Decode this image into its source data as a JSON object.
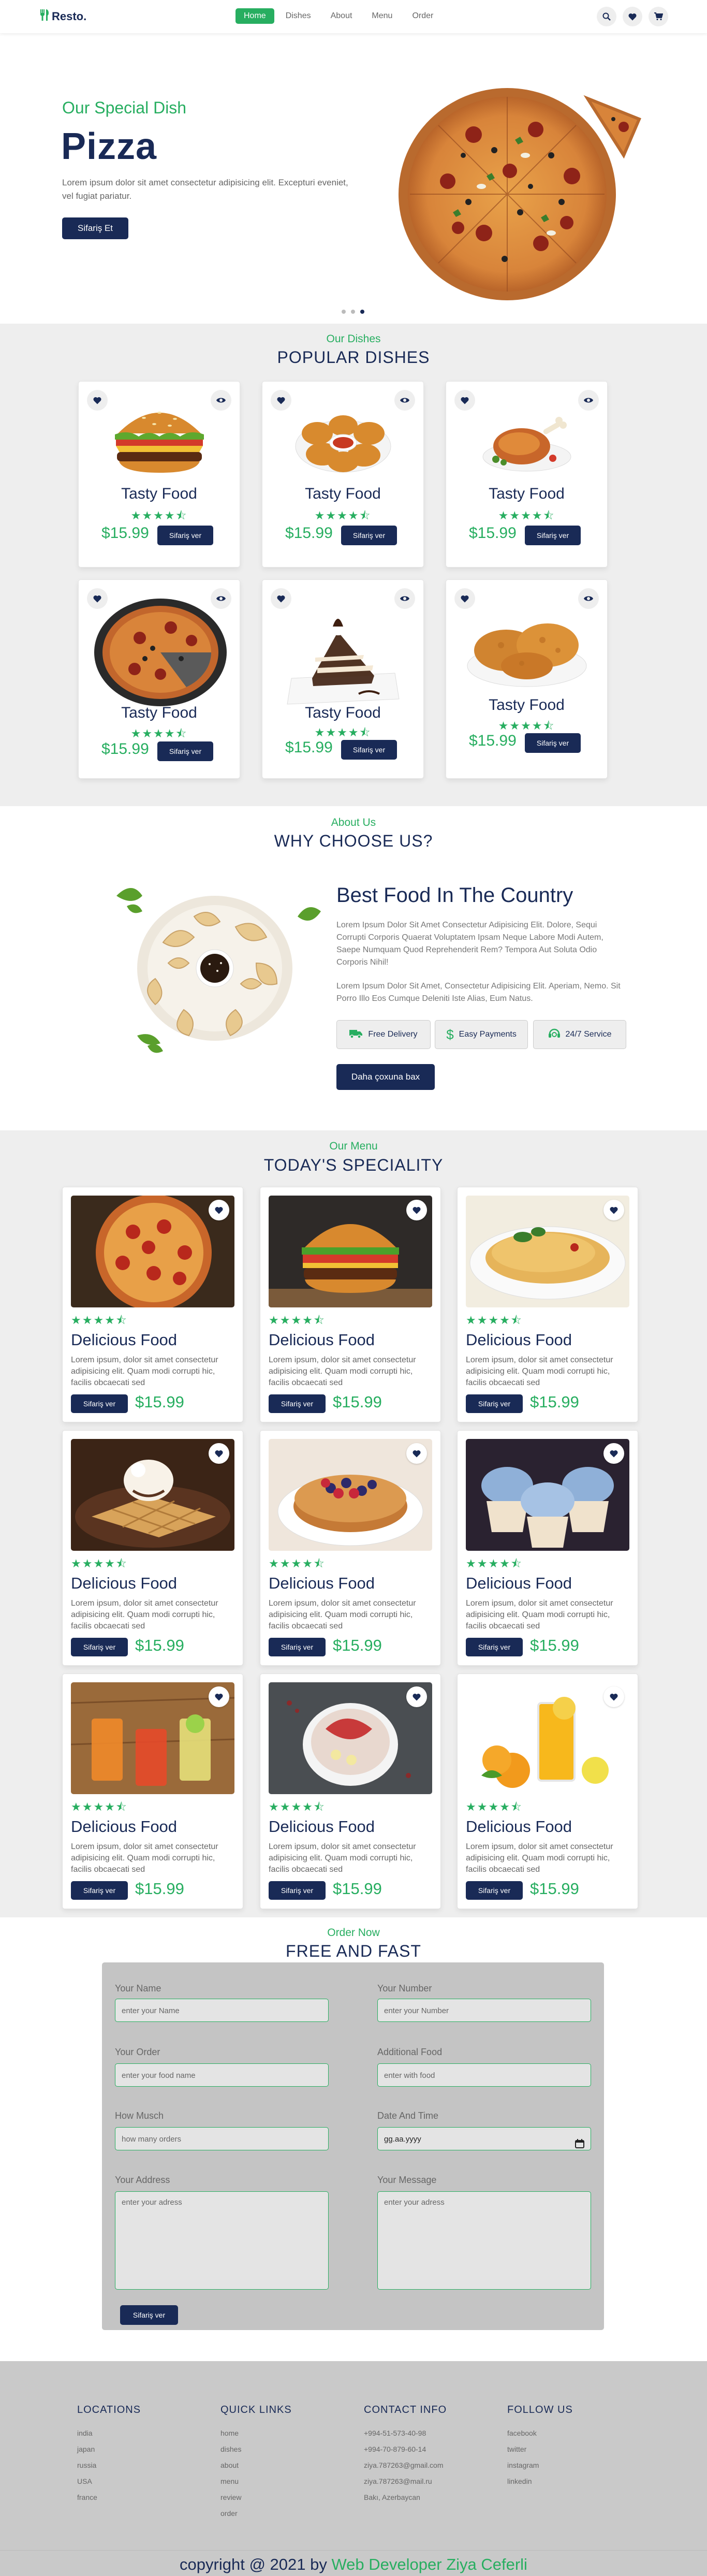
{
  "header": {
    "logo": "Resto.",
    "nav": [
      "Home",
      "Dishes",
      "About",
      "Menu",
      "Order"
    ],
    "active_nav": "Home",
    "icons": [
      "search-icon",
      "heart-icon",
      "cart-icon"
    ]
  },
  "hero": {
    "subtitle": "Our Special Dish",
    "title": "Pizza",
    "description": "Lorem ipsum dolor sit amet consectetur adipisicing elit. Excepturi eveniet, vel fugiat pariatur.",
    "button": "Sifariş Et",
    "slides_count": 3,
    "active_slide": 3
  },
  "dishes": {
    "subtitle": "Our Dishes",
    "title": "POPULAR DISHES",
    "items": [
      {
        "name": "Tasty Food",
        "price": "$15.99",
        "button": "Sifariş ver",
        "rating": 4.5,
        "image": "burger"
      },
      {
        "name": "Tasty Food",
        "price": "$15.99",
        "button": "Sifariş ver",
        "rating": 4.5,
        "image": "nuggets"
      },
      {
        "name": "Tasty Food",
        "price": "$15.99",
        "button": "Sifariş ver",
        "rating": 4.5,
        "image": "chicken-leg"
      },
      {
        "name": "Tasty Food",
        "price": "$15.99",
        "button": "Sifariş ver",
        "rating": 4.5,
        "image": "pizza-pan"
      },
      {
        "name": "Tasty Food",
        "price": "$15.99",
        "button": "Sifariş ver",
        "rating": 4.5,
        "image": "cake"
      },
      {
        "name": "Tasty Food",
        "price": "$15.99",
        "button": "Sifariş ver",
        "rating": 4.5,
        "image": "fried-chicken"
      }
    ]
  },
  "about": {
    "subtitle": "About Us",
    "title": "WHY CHOOSE US?",
    "heading": "Best Food In The Country",
    "p1": "Lorem Ipsum Dolor Sit Amet Consectetur Adipisicing Elit. Dolore, Sequi Corrupti Corporis Quaerat Voluptatem Ipsam Neque Labore Modi Autem, Saepe Numquam Quod Reprehenderit Rem? Tempora Aut Soluta Odio Corporis Nihil!",
    "p2": "Lorem Ipsum Dolor Sit Amet, Consectetur Adipisicing Elit. Aperiam, Nemo. Sit Porro Illo Eos Cumque Deleniti Iste Alias, Eum Natus.",
    "features": [
      "Free Delivery",
      "Easy Payments",
      "24/7 Service"
    ],
    "button": "Daha çoxuna bax"
  },
  "menu": {
    "subtitle": "Our Menu",
    "title": "TODAY'S SPECIALITY",
    "item_name": "Delicious Food",
    "item_desc": "Lorem ipsum, dolor sit amet consectetur adipisicing elit. Quam modi corrupti hic, facilis obcaecati sed",
    "item_price": "$15.99",
    "item_button": "Sifariş ver",
    "images": [
      "pizza",
      "burger",
      "crepes",
      "waffle",
      "pancake",
      "cupcakes",
      "juices",
      "bowl",
      "orange-juice"
    ]
  },
  "order": {
    "subtitle": "Order Now",
    "title": "FREE AND FAST",
    "fields": {
      "name": {
        "label": "Your Name",
        "placeholder": "enter your Name"
      },
      "number": {
        "label": "Your Number",
        "placeholder": "enter your Number"
      },
      "order": {
        "label": "Your Order",
        "placeholder": "enter your food name"
      },
      "additional": {
        "label": "Additional Food",
        "placeholder": "enter with food"
      },
      "how_much": {
        "label": "How Musch",
        "placeholder": "how many orders"
      },
      "date": {
        "label": "Date And Time",
        "placeholder": "gg.aa.yyyy"
      },
      "address": {
        "label": "Your Address",
        "placeholder": "enter your adress"
      },
      "message": {
        "label": "Your Message",
        "placeholder": "enter your adress"
      }
    },
    "button": "Sifariş ver"
  },
  "footer": {
    "locations": {
      "title": "LOCATIONS",
      "items": [
        "india",
        "japan",
        "russia",
        "USA",
        "france"
      ]
    },
    "quick_links": {
      "title": "QUICK LINKS",
      "items": [
        "home",
        "dishes",
        "about",
        "menu",
        "review",
        "order"
      ]
    },
    "contact": {
      "title": "CONTACT INFO",
      "items": [
        "+994-51-573-40-98",
        "+994-70-879-60-14",
        "ziya.787263@gmail.com",
        "ziya.787263@mail.ru",
        "Bakı, Azerbaycan"
      ]
    },
    "follow": {
      "title": "FOLLOW US",
      "items": [
        "facebook",
        "twitter",
        "instagram",
        "linkedin"
      ]
    },
    "copyright_prefix": "copyright @ 2021 by",
    "copyright_author": "Web Developer Ziya Ceferli"
  },
  "colors": {
    "accent": "#27ae60",
    "navy": "#192a56",
    "light_bg": "#eeeeee"
  }
}
